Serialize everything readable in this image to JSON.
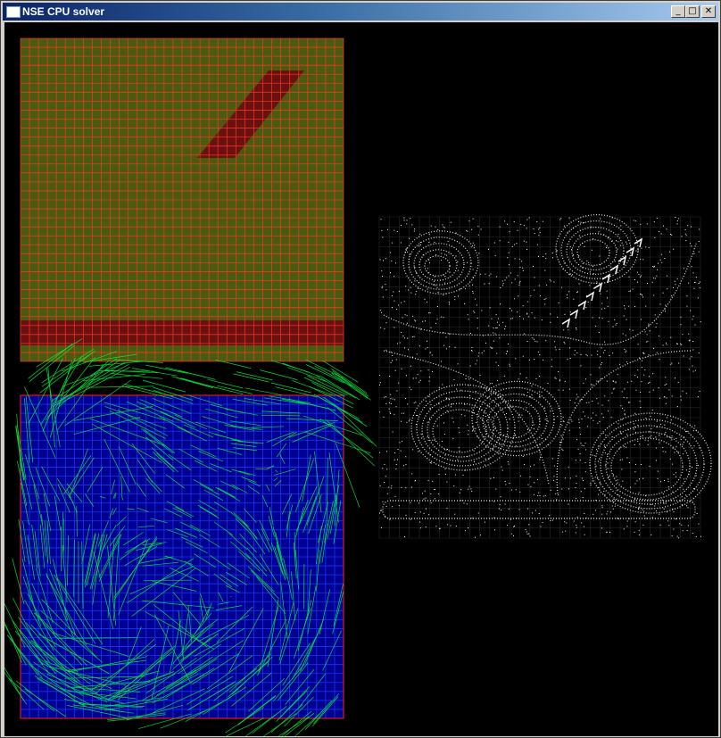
{
  "window": {
    "title": "NSE CPU solver",
    "app_icon": "window-icon",
    "controls": [
      {
        "name": "minimize-button",
        "glyph": "_"
      },
      {
        "name": "maximize-button",
        "glyph": "□"
      },
      {
        "name": "close-button",
        "glyph": "✕"
      }
    ]
  },
  "panels": {
    "pressure": {
      "grid_color": "#ff3b1f",
      "fill_color": "#4a5a10",
      "obstacle_color": "#6a1010"
    },
    "velocity": {
      "grid_color": "#1e3cff",
      "border_color": "#ff2020",
      "vector_color": "#00ff40",
      "fill_color": "#000090"
    },
    "particles": {
      "particle_color": "#ffffff",
      "grid_color": "#2a2a2a"
    }
  }
}
